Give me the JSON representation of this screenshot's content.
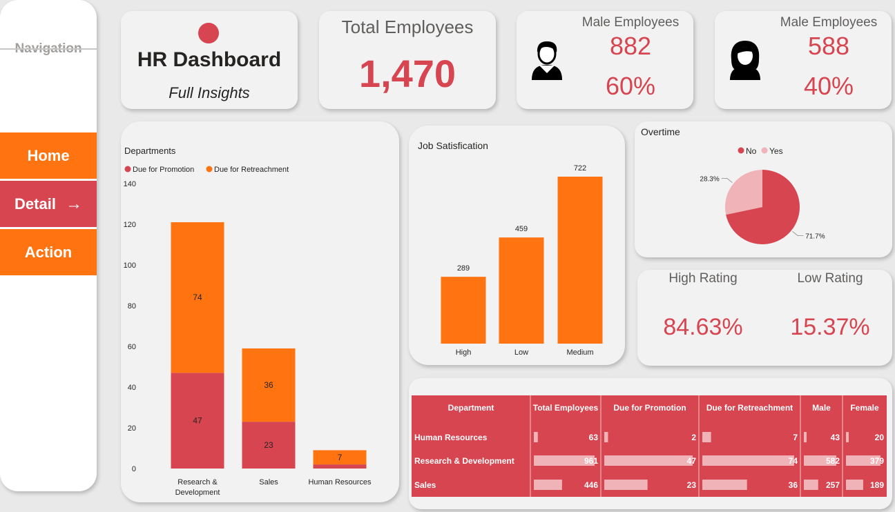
{
  "nav": {
    "title": "Navigation",
    "items": [
      {
        "label": "Home"
      },
      {
        "label": "Detail",
        "arrow": "→"
      },
      {
        "label": "Action"
      }
    ]
  },
  "header": {
    "title": "HR Dashboard",
    "subtitle": "Full Insights"
  },
  "kpi": {
    "total": {
      "label": "Total Employees",
      "value": "1,470"
    },
    "male": {
      "label": "Male Employees",
      "count": "882",
      "pct": "60%"
    },
    "female": {
      "label": "Male Employees",
      "count": "588",
      "pct": "40%"
    }
  },
  "rating": {
    "high": {
      "label": "High Rating",
      "value": "84.63%"
    },
    "low": {
      "label": "Low Rating",
      "value": "15.37%"
    }
  },
  "colors": {
    "red": "#d64550",
    "orange": "#ff7410",
    "pink": "#f0b3b8",
    "card": "#f2f2f2"
  },
  "chart_data": [
    {
      "type": "bar",
      "stacked": true,
      "title": "Departments",
      "categories": [
        "Research & Development",
        "Sales",
        "Human Resources"
      ],
      "category_lines": [
        [
          "Research &",
          "Development"
        ],
        [
          "Sales"
        ],
        [
          "Human Resources"
        ]
      ],
      "series": [
        {
          "name": "Due for Promotion",
          "values": [
            47,
            23,
            2
          ],
          "labels": [
            "47",
            "23",
            ""
          ],
          "color": "#d64550"
        },
        {
          "name": "Due for Retreachment",
          "values": [
            74,
            36,
            7
          ],
          "labels": [
            "74",
            "36",
            "7"
          ],
          "color": "#ff7410"
        }
      ],
      "ylim": [
        0,
        140
      ],
      "yticks": [
        0,
        20,
        40,
        60,
        80,
        100,
        120,
        140
      ],
      "legend": "top-left",
      "grid": false
    },
    {
      "type": "bar",
      "title": "Job Satisfication",
      "categories": [
        "High",
        "Low",
        "Medium"
      ],
      "values": [
        289,
        459,
        722
      ],
      "color": "#ff7410",
      "ylim": [
        0,
        722
      ],
      "grid": false
    },
    {
      "type": "pie",
      "title": "Overtime",
      "slices": [
        {
          "name": "No",
          "value": 71.7,
          "label": "71.7%",
          "color": "#d64550"
        },
        {
          "name": "Yes",
          "value": 28.3,
          "label": "28.3%",
          "color": "#f0b3b8"
        }
      ],
      "legend": "top"
    },
    {
      "type": "table",
      "columns": [
        "Department",
        "Total Employees",
        "Due for Promotion",
        "Due for Retreachment",
        "Male",
        "Female"
      ],
      "rows": [
        {
          "dept": "Human Resources",
          "values": [
            63,
            2,
            7,
            43,
            20
          ]
        },
        {
          "dept": "Research & Development",
          "values": [
            961,
            47,
            74,
            582,
            379
          ]
        },
        {
          "dept": "Sales",
          "values": [
            446,
            23,
            36,
            257,
            189
          ]
        }
      ],
      "bar_color": "#f0b3b8",
      "header_color": "#d64550"
    }
  ]
}
